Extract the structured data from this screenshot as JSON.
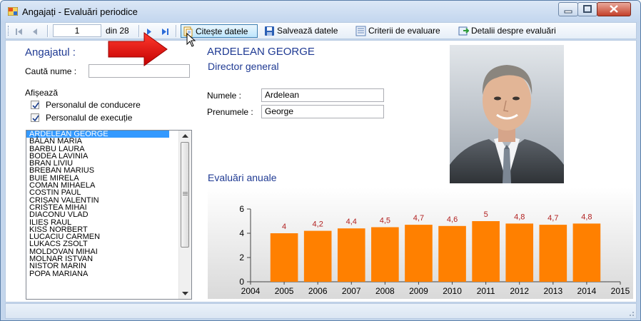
{
  "window": {
    "title": "Angajați - Evaluări periodice"
  },
  "toolbar": {
    "position": "1",
    "total": "din 28",
    "read_label": "Citește datele",
    "save_label": "Salvează datele",
    "criteria_label": "Criterii de evaluare",
    "details_label": "Detalii despre evaluări"
  },
  "left": {
    "header": "Angajatul :",
    "search_label": "Caută nume :",
    "search_value": "",
    "show_label": "Afișează",
    "chk_management": "Personalul de conducere",
    "chk_execution": "Personalul de execuție",
    "employees": [
      "ARDELEAN GEORGE",
      "BĂLAN MARIA",
      "BARBU LAURA",
      "BODEA LAVINIA",
      "BRAN LIVIU",
      "BREBAN MARIUS",
      "BUIE MIRELA",
      "COMAN MIHAELA",
      "COSTIN PAUL",
      "CRIȘAN VALENTIN",
      "CRISTEA MIHAI",
      "DIACONU VLAD",
      "ILIEȘ RAUL",
      "KISS NORBERT",
      "LUCACIU CARMEN",
      "LUKACS ZSOLT",
      "MOLDOVAN MIHAI",
      "MOLNAR ISTVAN",
      "NISTOR MARIN",
      "POPA MARIANA"
    ]
  },
  "detail": {
    "full_name": "ARDELEAN GEORGE",
    "job_title": "Director general",
    "last_name_label": "Numele :",
    "last_name": "Ardelean",
    "first_name_label": "Prenumele :",
    "first_name": "George",
    "chart_title": "Evaluări anuale"
  },
  "colors": {
    "bar": "#ff8000",
    "label": "#b22222",
    "title_blue": "#1f3a93",
    "selection": "#3399ff"
  },
  "chart_data": {
    "type": "bar",
    "categories": [
      "2005",
      "2006",
      "2007",
      "2008",
      "2009",
      "2010",
      "2011",
      "2012",
      "2013",
      "2014"
    ],
    "values": [
      4,
      4.2,
      4.4,
      4.5,
      4.7,
      4.6,
      5,
      4.8,
      4.7,
      4.8
    ],
    "value_labels": [
      "4",
      "4,2",
      "4,4",
      "4,5",
      "4,7",
      "4,6",
      "5",
      "4,8",
      "4,7",
      "4,8"
    ],
    "x_ticks": [
      "2004",
      "2005",
      "2006",
      "2007",
      "2008",
      "2009",
      "2010",
      "2011",
      "2012",
      "2013",
      "2014",
      "2015"
    ],
    "y_ticks": [
      "0",
      "2",
      "4",
      "6"
    ],
    "ylim": [
      0,
      6
    ],
    "xlim": [
      2004,
      2015
    ],
    "grid": false,
    "legend": "none"
  }
}
